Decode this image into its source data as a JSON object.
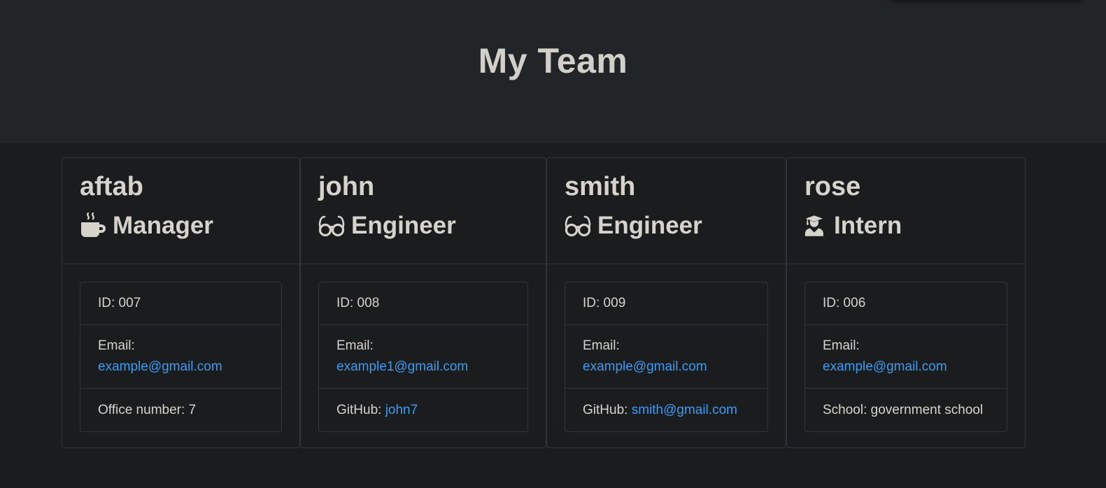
{
  "header": {
    "title": "My Team"
  },
  "colors": {
    "link": "#3d9bf2",
    "background": "#1b1c1e",
    "header_bg": "#222527",
    "text": "#d6d3cd"
  },
  "cards": [
    {
      "name": "aftab",
      "role": "Manager",
      "icon": "coffee-cup-icon",
      "id_text": "ID: 007",
      "email_label": "Email:",
      "email": "example@gmail.com",
      "extra_label": "Office number: 7",
      "extra_value": ""
    },
    {
      "name": "john",
      "role": "Engineer",
      "icon": "glasses-icon",
      "id_text": "ID: 008",
      "email_label": "Email:",
      "email": "example1@gmail.com",
      "extra_label": "GitHub: ",
      "extra_value": "john7"
    },
    {
      "name": "smith",
      "role": "Engineer",
      "icon": "glasses-icon",
      "id_text": "ID: 009",
      "email_label": "Email:",
      "email": "example@gmail.com",
      "extra_label": "GitHub: ",
      "extra_value": "smith@gmail.com"
    },
    {
      "name": "rose",
      "role": "Intern",
      "icon": "graduate-icon",
      "id_text": "ID: 006",
      "email_label": "Email:",
      "email": "example@gmail.com",
      "extra_label": "School: government school",
      "extra_value": ""
    }
  ]
}
